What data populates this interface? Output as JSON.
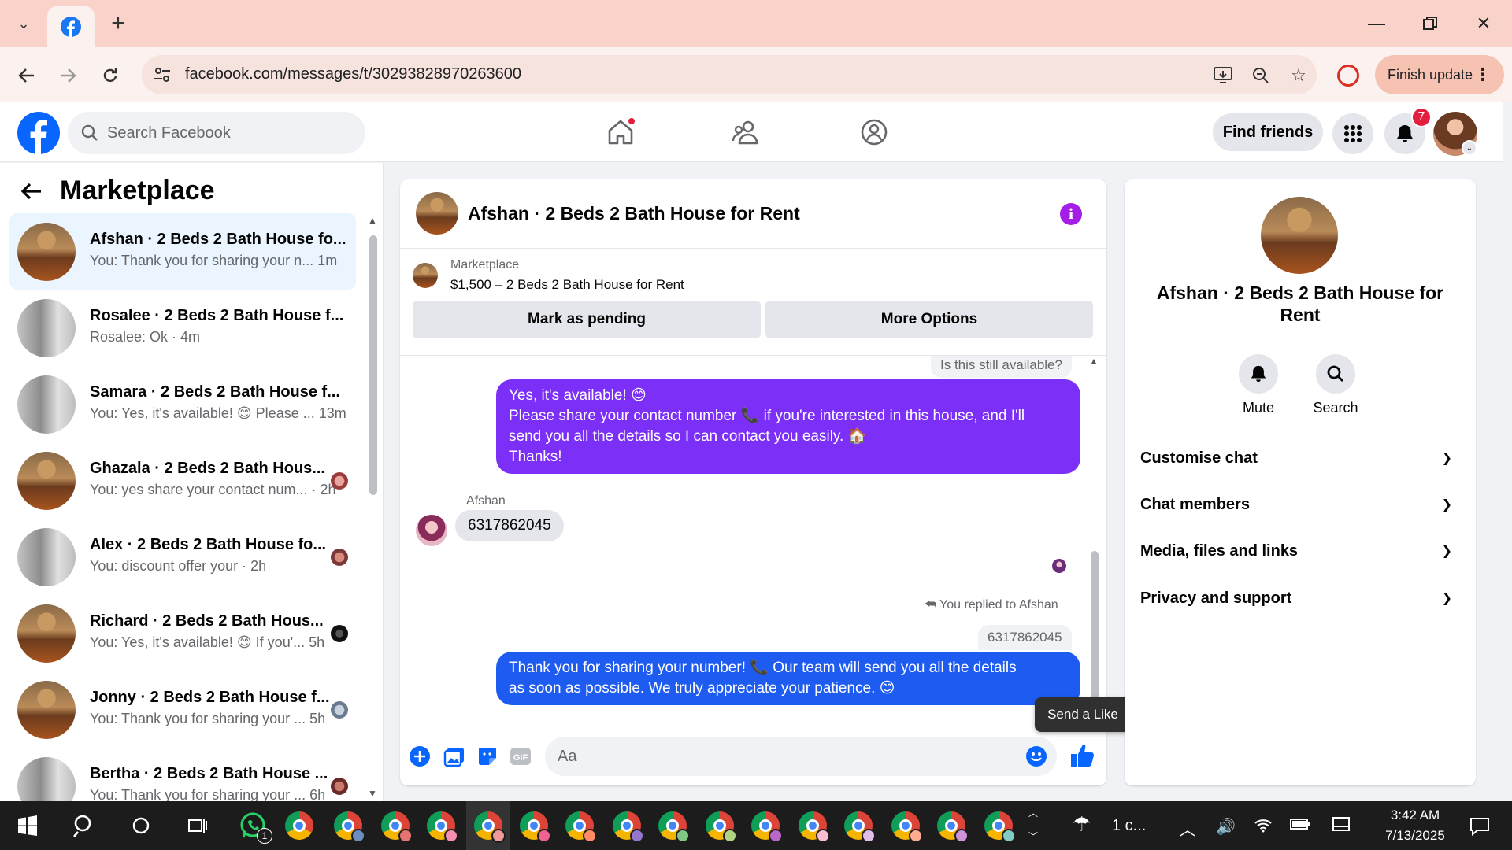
{
  "browser": {
    "url": "facebook.com/messages/t/30293828970263600",
    "finish_update": "Finish update"
  },
  "fb": {
    "search_placeholder": "Search Facebook",
    "find_friends": "Find friends",
    "notifications_count": "7"
  },
  "left": {
    "title": "Marketplace",
    "conversations": [
      {
        "name": "Afshan · 2 Beds 2 Bath House fo...",
        "snippet": "You: Thank you for sharing your n...   1m",
        "thumb": "room",
        "active": true
      },
      {
        "name": "Rosalee · 2 Beds 2 Bath House f...",
        "snippet": "Rosalee: Ok · 4m",
        "thumb": "bath"
      },
      {
        "name": "Samara · 2 Beds 2 Bath House f...",
        "snippet": "You: Yes, it's available! 😊 Please ...   13m",
        "thumb": "bath"
      },
      {
        "name": "Ghazala · 2 Beds 2 Bath Hous...",
        "snippet": "You: yes share your contact num... · 2h",
        "thumb": "room"
      },
      {
        "name": "Alex · 2 Beds 2 Bath House fo...",
        "snippet": "You: discount offer your · 2h",
        "thumb": "bath"
      },
      {
        "name": "Richard · 2 Beds 2 Bath Hous...",
        "snippet": "You: Yes, it's available! 😊 If you'...   5h",
        "thumb": "room"
      },
      {
        "name": "Jonny · 2 Beds 2 Bath House f...",
        "snippet": "You: Thank you for sharing your ...   5h",
        "thumb": "room"
      },
      {
        "name": "Bertha · 2 Beds 2 Bath House ...",
        "snippet": "You: Thank you for sharing your ...   6h",
        "thumb": "bath"
      }
    ]
  },
  "chat": {
    "title": "Afshan · 2 Beds 2 Bath House for Rent",
    "listing_source": "Marketplace",
    "listing_price": "$1,500 – 2 Beds 2 Bath House for Rent",
    "mark_pending": "Mark as pending",
    "more_options": "More Options",
    "msg_question": "Is this still available?",
    "msg_out1_l1": "Yes, it's available! 😊",
    "msg_out1_l2": "Please share your contact number 📞 if you're interested in this house, and I'll",
    "msg_out1_l3": "send you all the details so I can contact you easily. 🏠",
    "msg_out1_l4": "Thanks!",
    "sender_name": "Afshan",
    "msg_in": "6317862045",
    "replied_label": "You replied to Afshan",
    "quoted": "6317862045",
    "msg_out2_l1": "Thank you for sharing your number! 📞 Our team will send you all the details",
    "msg_out2_l2": "as soon as possible. We truly appreciate your patience. 😊",
    "composer_placeholder": "Aa",
    "tooltip": "Send a Like",
    "colors": {
      "purple": "#7b2ff7",
      "blue": "#1e5bf0"
    }
  },
  "right": {
    "title": "Afshan · 2 Beds 2 Bath House for Rent",
    "mute": "Mute",
    "search": "Search",
    "sections": [
      "Customise chat",
      "Chat members",
      "Media, files and links",
      "Privacy and support"
    ]
  },
  "taskbar": {
    "weather": "1 c...",
    "time": "3:42 AM",
    "date": "7/13/2025",
    "whatsapp_badge": "1"
  }
}
